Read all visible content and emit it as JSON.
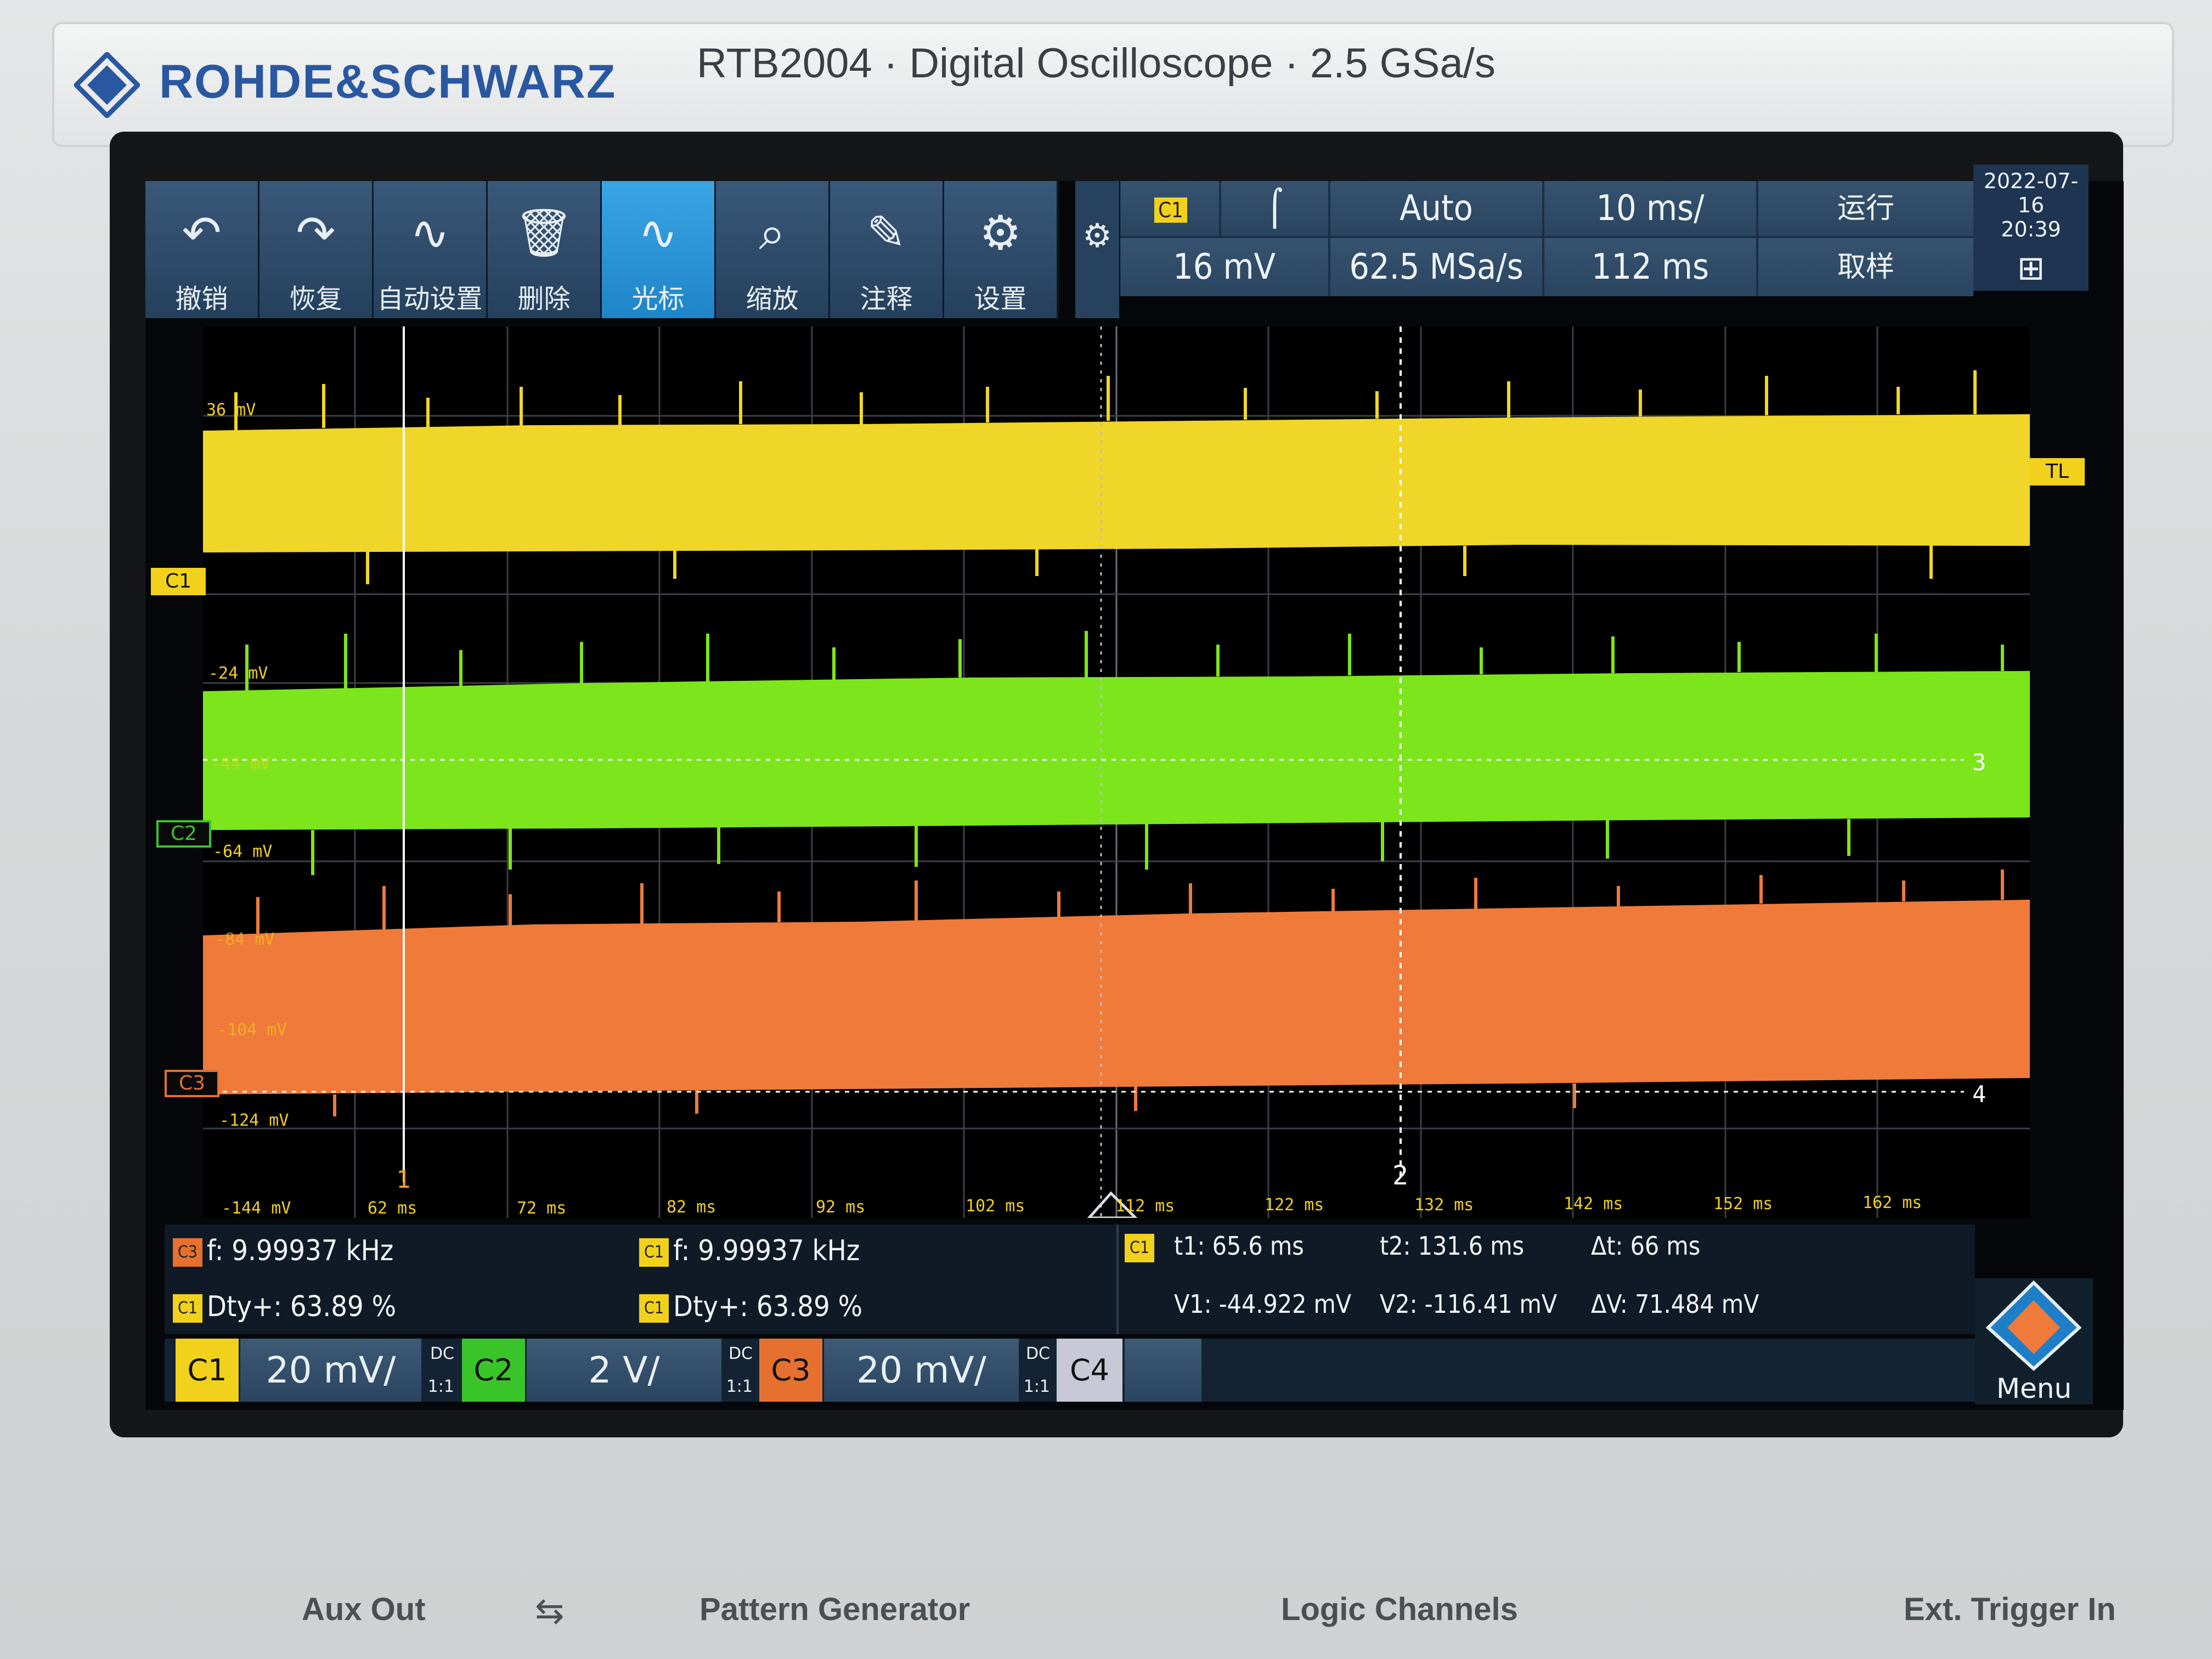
{
  "device": {
    "brand": "ROHDE&SCHWARZ",
    "model_line": "RTB2004 · Digital Oscilloscope · 2.5 GSa/s"
  },
  "toolbar": {
    "items": [
      {
        "label": "撤销",
        "icon": "undo-icon"
      },
      {
        "label": "恢复",
        "icon": "redo-icon"
      },
      {
        "label": "自动设置",
        "icon": "autoset-icon"
      },
      {
        "label": "删除",
        "icon": "trash-icon"
      },
      {
        "label": "光标",
        "icon": "sine-wave-icon"
      },
      {
        "label": "缩放",
        "icon": "zoom-icon"
      },
      {
        "label": "注释",
        "icon": "pencil-icon"
      },
      {
        "label": "设置",
        "icon": "gear-icon"
      }
    ],
    "active_index": 4
  },
  "acquisition": {
    "trigger_source": "C1",
    "trigger_level": "16 mV",
    "trigger_mode": "Auto",
    "sample_rate": "62.5 MSa/s",
    "time_scale": "10 ms/",
    "time_position": "112 ms",
    "run_state": "运行",
    "sample_mode": "取样"
  },
  "datetime": {
    "date": "2022-07-16",
    "time": "20:39"
  },
  "grid": {
    "voltage_labels": [
      "36 mV",
      "-24 mV",
      "-44 mV",
      "-64 mV",
      "-84 mV",
      "-104 mV",
      "-124 mV",
      "-144 mV"
    ],
    "time_labels": [
      "62 ms",
      "72 ms",
      "82 ms",
      "92 ms",
      "102 ms",
      "112 ms",
      "122 ms",
      "132 ms",
      "142 ms",
      "152 ms",
      "162 ms"
    ],
    "markers": {
      "tl": "TL",
      "c1": "C1",
      "c2": "C2",
      "c3": "C3",
      "ref3": "3",
      "ref4": "4",
      "cursor1": "1",
      "cursor2": "2"
    }
  },
  "measurements": {
    "c3_freq": "f: 9.99937 kHz",
    "c1_duty_left": "Dty+: 63.89 %",
    "c1_freq": "f: 9.99937 kHz",
    "c1_duty_right": "Dty+: 63.89 %",
    "cursor_source": "C1",
    "t1": "t1: 65.6 ms",
    "t2": "t2: 131.6 ms",
    "dt": "Δt: 66 ms",
    "v1": "V1: -44.922 mV",
    "v2": "V2: -116.41 mV",
    "dv": "ΔV: 71.484 mV"
  },
  "channels": [
    {
      "name": "C1",
      "scale": "20 mV/",
      "coupling": "DC",
      "probe": "1:1",
      "color": "#f2d11c"
    },
    {
      "name": "C2",
      "scale": "2 V/",
      "coupling": "DC",
      "probe": "1:1",
      "color": "#39c52a"
    },
    {
      "name": "C3",
      "scale": "20 mV/",
      "coupling": "DC",
      "probe": "1:1",
      "color": "#e5702f"
    },
    {
      "name": "C4",
      "color": "#c8c8d6"
    }
  ],
  "menu_label": "Menu",
  "front_panel": [
    "Aux Out",
    "Pattern Generator",
    "Logic Channels",
    "Ext. Trigger In"
  ],
  "colors": {
    "c1": "#f2d11c",
    "c2": "#7ee21a",
    "c3": "#f07a3a",
    "accent": "#2a58a0"
  }
}
